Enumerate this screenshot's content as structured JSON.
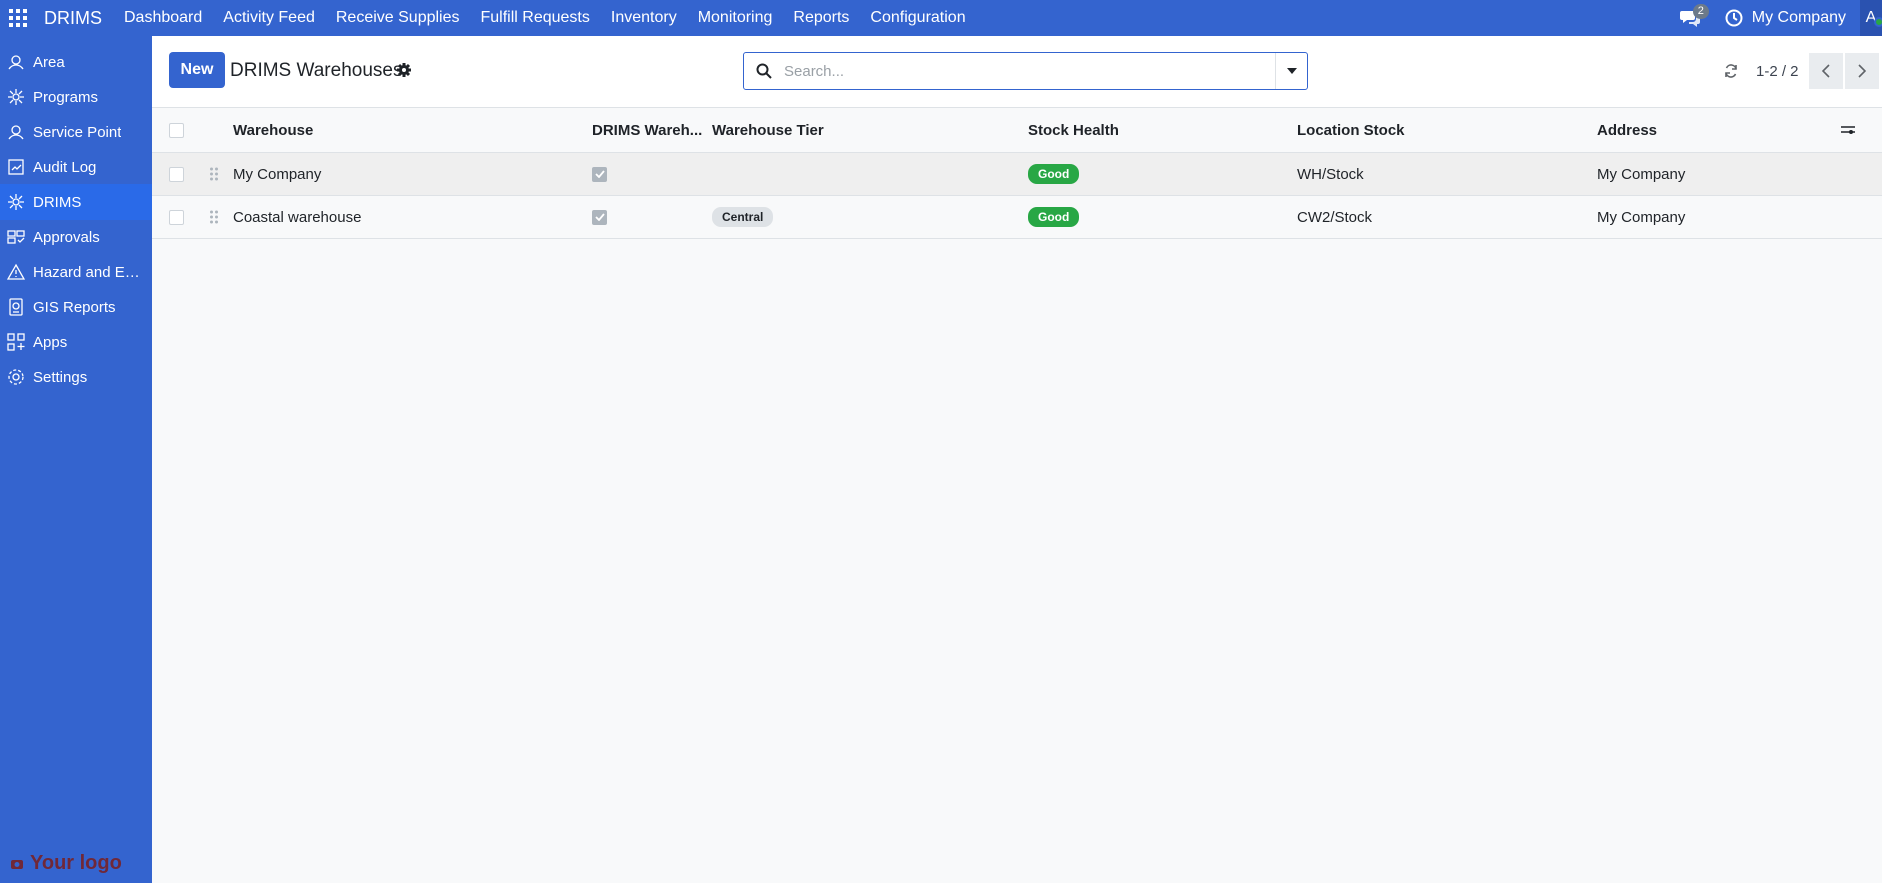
{
  "navbar": {
    "brand": "DRIMS",
    "menu": [
      "Dashboard",
      "Activity Feed",
      "Receive Supplies",
      "Fulfill Requests",
      "Inventory",
      "Monitoring",
      "Reports",
      "Configuration"
    ],
    "chat_count": "2",
    "company": "My Company",
    "avatar_initial": "A"
  },
  "sidebar": {
    "items": [
      {
        "label": "Area",
        "icon": "area-icon"
      },
      {
        "label": "Programs",
        "icon": "programs-icon"
      },
      {
        "label": "Service Point",
        "icon": "service-point-icon"
      },
      {
        "label": "Audit Log",
        "icon": "audit-log-icon"
      },
      {
        "label": "DRIMS",
        "icon": "drims-icon",
        "active": true
      },
      {
        "label": "Approvals",
        "icon": "approvals-icon"
      },
      {
        "label": "Hazard and Em...",
        "icon": "hazard-icon"
      },
      {
        "label": "GIS Reports",
        "icon": "gis-reports-icon"
      },
      {
        "label": "Apps",
        "icon": "apps-icon"
      },
      {
        "label": "Settings",
        "icon": "settings-icon"
      }
    ],
    "logo_text": "Your logo"
  },
  "control": {
    "new_label": "New",
    "title": "DRIMS Warehouses",
    "search_placeholder": "Search...",
    "pager_value": "1-2 / 2"
  },
  "table": {
    "headers": {
      "warehouse": "Warehouse",
      "drims_warehouse": "DRIMS Wareh...",
      "tier": "Warehouse Tier",
      "stock_health": "Stock Health",
      "location_stock": "Location Stock",
      "address": "Address"
    },
    "rows": [
      {
        "warehouse": "My Company",
        "drims": true,
        "tier": "",
        "stock_health": "Good",
        "location_stock": "WH/Stock",
        "address": "My Company"
      },
      {
        "warehouse": "Coastal warehouse",
        "drims": true,
        "tier": "Central",
        "stock_health": "Good",
        "location_stock": "CW2/Stock",
        "address": "My Company"
      }
    ]
  },
  "colors": {
    "brand": "#3464cf",
    "active_sidebar": "#2a6ae8",
    "good": "#28a745"
  }
}
